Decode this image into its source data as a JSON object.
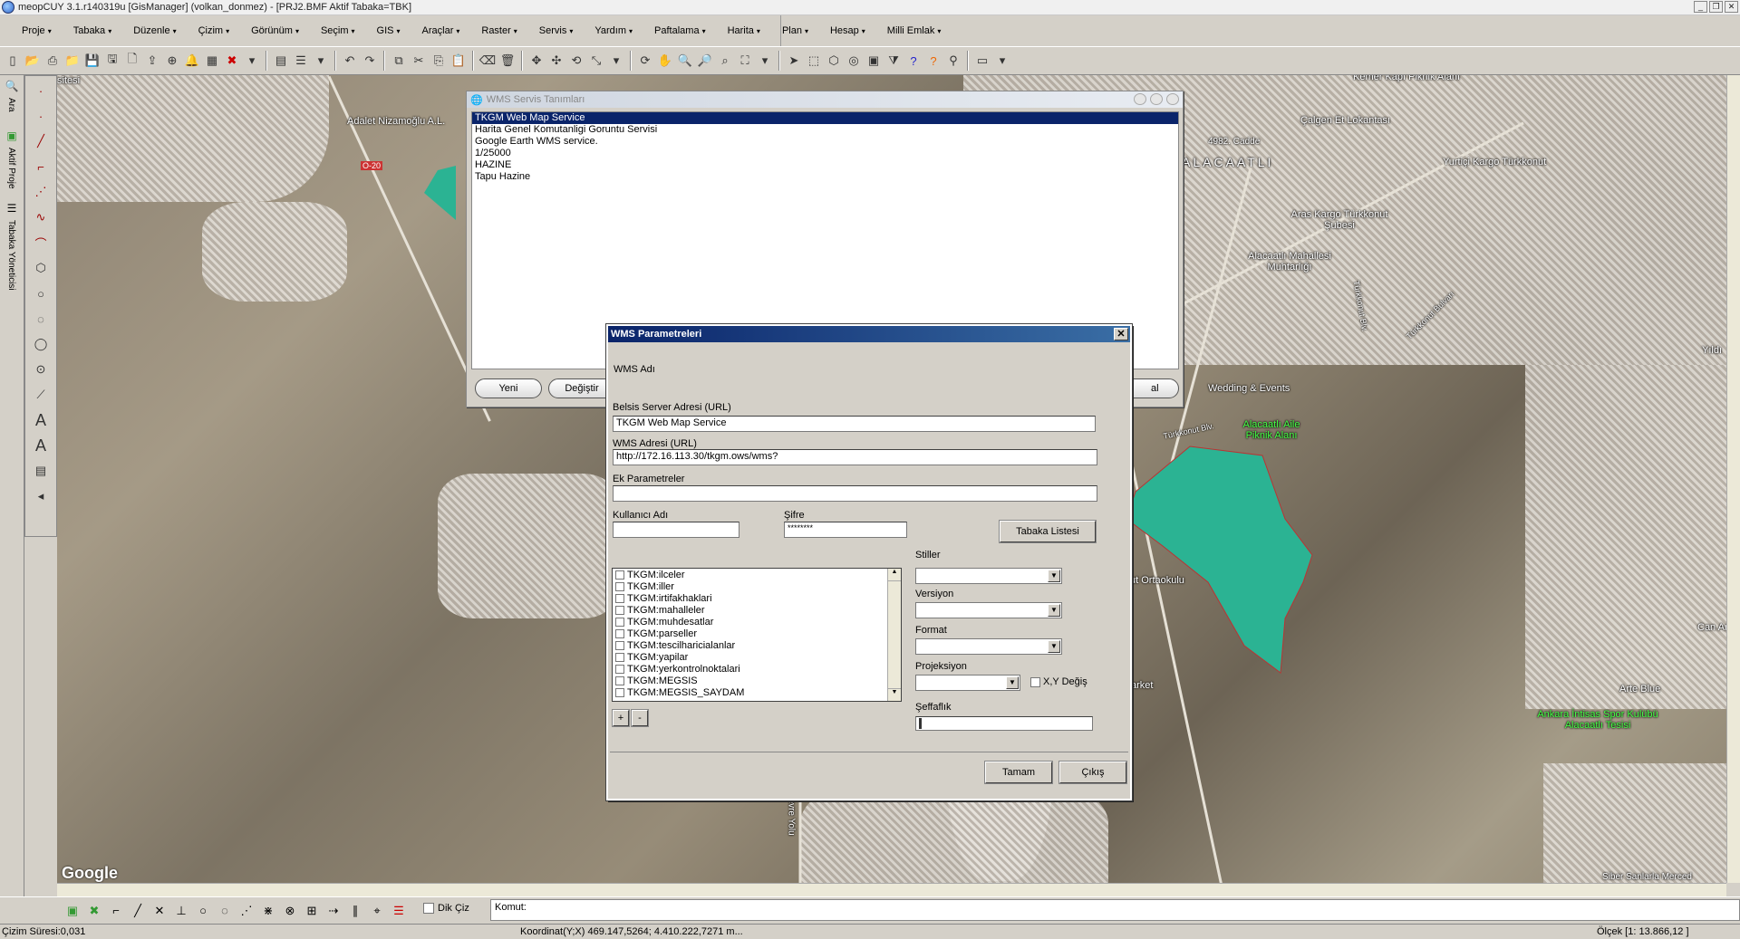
{
  "window": {
    "title": "meopCUY 3.1.r140319u [GisManager] (volkan_donmez)  - [PRJ2.BMF  Aktif Tabaka=TBK]"
  },
  "menu": [
    "Proje",
    "Tabaka",
    "Düzenle",
    "Çizim",
    "Görünüm",
    "Seçim",
    "GIS",
    "Araçlar",
    "Raster",
    "Servis",
    "Yardım",
    "Paftalama",
    "Harita",
    "Plan",
    "Hesap",
    "Milli Emlak"
  ],
  "left_panel": {
    "tab1": "Ara",
    "tab2": "Aktif Proje",
    "tab3": "Tabaka Yöneticisi"
  },
  "map": {
    "labels": [
      "Adalet Nizamoğlu A.L.",
      "O-20",
      "Kemer Kapı Piknik Alanı",
      "Çalgen Et Lokantası",
      "4982. Cadde",
      "Yurtiçi Kargo Türkkonut",
      "Aras Kargo Türkkonut Şubesi",
      "Alacaatlı Mahallesi Muhtarlığı",
      "Türkkonut Blv.",
      "Türkkonut Bulvarı",
      "Wedding & Events",
      "Alacaatlı Aile Piknik Alanı",
      "Türkkonut Blv.",
      "ut Ortaokulu",
      "arket",
      "Ankara İntisas Spor Kulübü Alacaatlı Tesisi",
      "Arte Blue",
      "Can Ar",
      "Yıldı",
      "Çevre Yolu",
      "Siber Sanlarla Merced",
      "sitesi",
      "ALACAATLI"
    ],
    "google": "Google",
    "polygon_color": "#2bb393"
  },
  "wms_list_dialog": {
    "title": "WMS Servis Tanımları",
    "items": [
      "TKGM  Web Map Service",
      "Harita Genel Komutanligi Goruntu Servisi",
      "Google Earth WMS service.",
      "1/25000",
      "HAZINE",
      "Tapu Hazine"
    ],
    "selected_index": 0,
    "buttons": {
      "new": "Yeni",
      "edit": "Değiştir",
      "close": "al"
    }
  },
  "wms_params_dialog": {
    "title": "WMS Parametreleri",
    "wms_name_label": "WMS Adı",
    "server_label": "Belsis Server Adresi (URL)",
    "server_value": "TKGM  Web Map Service",
    "url_label": "WMS Adresi (URL)",
    "url_value": "http://172.16.113.30/tkgm.ows/wms?",
    "extra_label": "Ek Parametreler",
    "extra_value": "",
    "user_label": "Kullanıcı Adı",
    "user_value": "",
    "password_label": "Şifre",
    "password_value": "********",
    "layer_list_button": "Tabaka Listesi",
    "layers": [
      "TKGM:ilceler",
      "TKGM:iller",
      "TKGM:irtifakhaklari",
      "TKGM:mahalleler",
      "TKGM:muhdesatlar",
      "TKGM:parseller",
      "TKGM:tescilharicialanlar",
      "TKGM:yapilar",
      "TKGM:yerkontrolnoktalari",
      "TKGM:MEGSIS",
      "TKGM:MEGSIS_SAYDAM"
    ],
    "styles_label": "Stiller",
    "version_label": "Versiyon",
    "format_label": "Format",
    "projection_label": "Projeksiyon",
    "xy_swap_label": "X,Y Değiş",
    "opacity_label": "Şeffaflık",
    "add_button": "+",
    "remove_button": "-",
    "ok_button": "Tamam",
    "exit_button": "Çıkış"
  },
  "bottom": {
    "dik_ciz": "Dik Çiz",
    "komut": "Komut:"
  },
  "status": {
    "draw_time": "Çizim Süresi:0,031",
    "coordinates": "Koordinat(Y;X)  469.147,5264; 4.410.222,7271 m...",
    "scale": "Ölçek [1: 13.866,12 ]"
  }
}
